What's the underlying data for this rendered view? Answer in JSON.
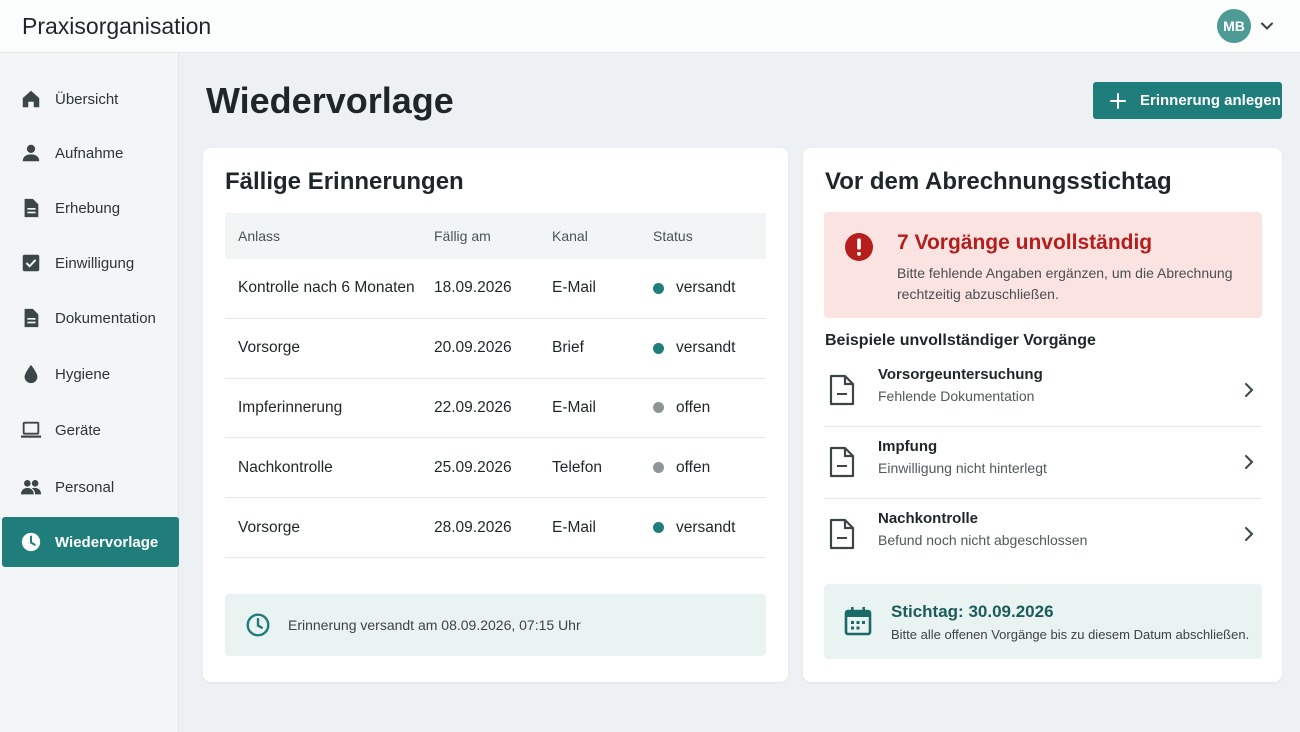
{
  "colors": {
    "accent": "#1f7d7b",
    "status_sent": "#1f7d7b",
    "status_open": "#8e9598",
    "alert_red": "#b41e1c",
    "alert_bg": "#fbe3e2",
    "info_bg": "#e9f4f2"
  },
  "header": {
    "app_title": "Praxisorganisation",
    "avatar_initials": "MB",
    "avatar_icon": "chevron-down-icon"
  },
  "sidebar": {
    "items": [
      {
        "label": "Übersicht",
        "icon": "home-icon",
        "active": false
      },
      {
        "label": "Aufnahme",
        "icon": "person-icon",
        "active": false
      },
      {
        "label": "Erhebung",
        "icon": "document-icon",
        "active": false
      },
      {
        "label": "Einwilligung",
        "icon": "checkbox-icon",
        "active": false
      },
      {
        "label": "Dokumentation",
        "icon": "document-icon",
        "active": false
      },
      {
        "label": "Hygiene",
        "icon": "drop-icon",
        "active": false
      },
      {
        "label": "Geräte",
        "icon": "laptop-icon",
        "active": false
      },
      {
        "label": "Personal",
        "icon": "people-icon",
        "active": false
      },
      {
        "label": "Wiedervorlage",
        "icon": "clock-icon",
        "active": true
      }
    ]
  },
  "main": {
    "title": "Wiedervorlage",
    "add_button_label": "Erinnerung anlegen"
  },
  "reminders": {
    "title": "Fällige Erinnerungen",
    "columns": [
      "Anlass",
      "Fällig am",
      "Kanal",
      "Status"
    ],
    "rows": [
      {
        "anlass": "Kontrolle nach 6 Monaten",
        "faellig": "18.09.2026",
        "kanal": "E-Mail",
        "status": "versandt",
        "state": "sent"
      },
      {
        "anlass": "Vorsorge",
        "faellig": "20.09.2026",
        "kanal": "Brief",
        "status": "versandt",
        "state": "sent"
      },
      {
        "anlass": "Impferinnerung",
        "faellig": "22.09.2026",
        "kanal": "E-Mail",
        "status": "offen",
        "state": "open"
      },
      {
        "anlass": "Nachkontrolle",
        "faellig": "25.09.2026",
        "kanal": "Telefon",
        "status": "offen",
        "state": "open"
      },
      {
        "anlass": "Vorsorge",
        "faellig": "28.09.2026",
        "kanal": "E-Mail",
        "status": "versandt",
        "state": "sent"
      }
    ],
    "footer_note": "Erinnerung versandt am 08.09.2026, 07:15 Uhr"
  },
  "billing": {
    "title": "Vor dem Abrechnungsstichtag",
    "alert_title": "7 Vorgänge unvollständig",
    "alert_text": "Bitte fehlende Angaben ergänzen, um die Abrechnung rechtzeitig abzuschließen.",
    "examples_title": "Beispiele unvollständiger Vorgänge",
    "cases": [
      {
        "title": "Vorsorgeuntersuchung",
        "subtitle": "Fehlende Dokumentation"
      },
      {
        "title": "Impfung",
        "subtitle": "Einwilligung nicht hinterlegt"
      },
      {
        "title": "Nachkontrolle",
        "subtitle": "Befund noch nicht abgeschlossen"
      }
    ],
    "deadline_title": "Stichtag: 30.09.2026",
    "deadline_text": "Bitte alle offenen Vorgänge bis zu diesem Datum abschließen."
  }
}
